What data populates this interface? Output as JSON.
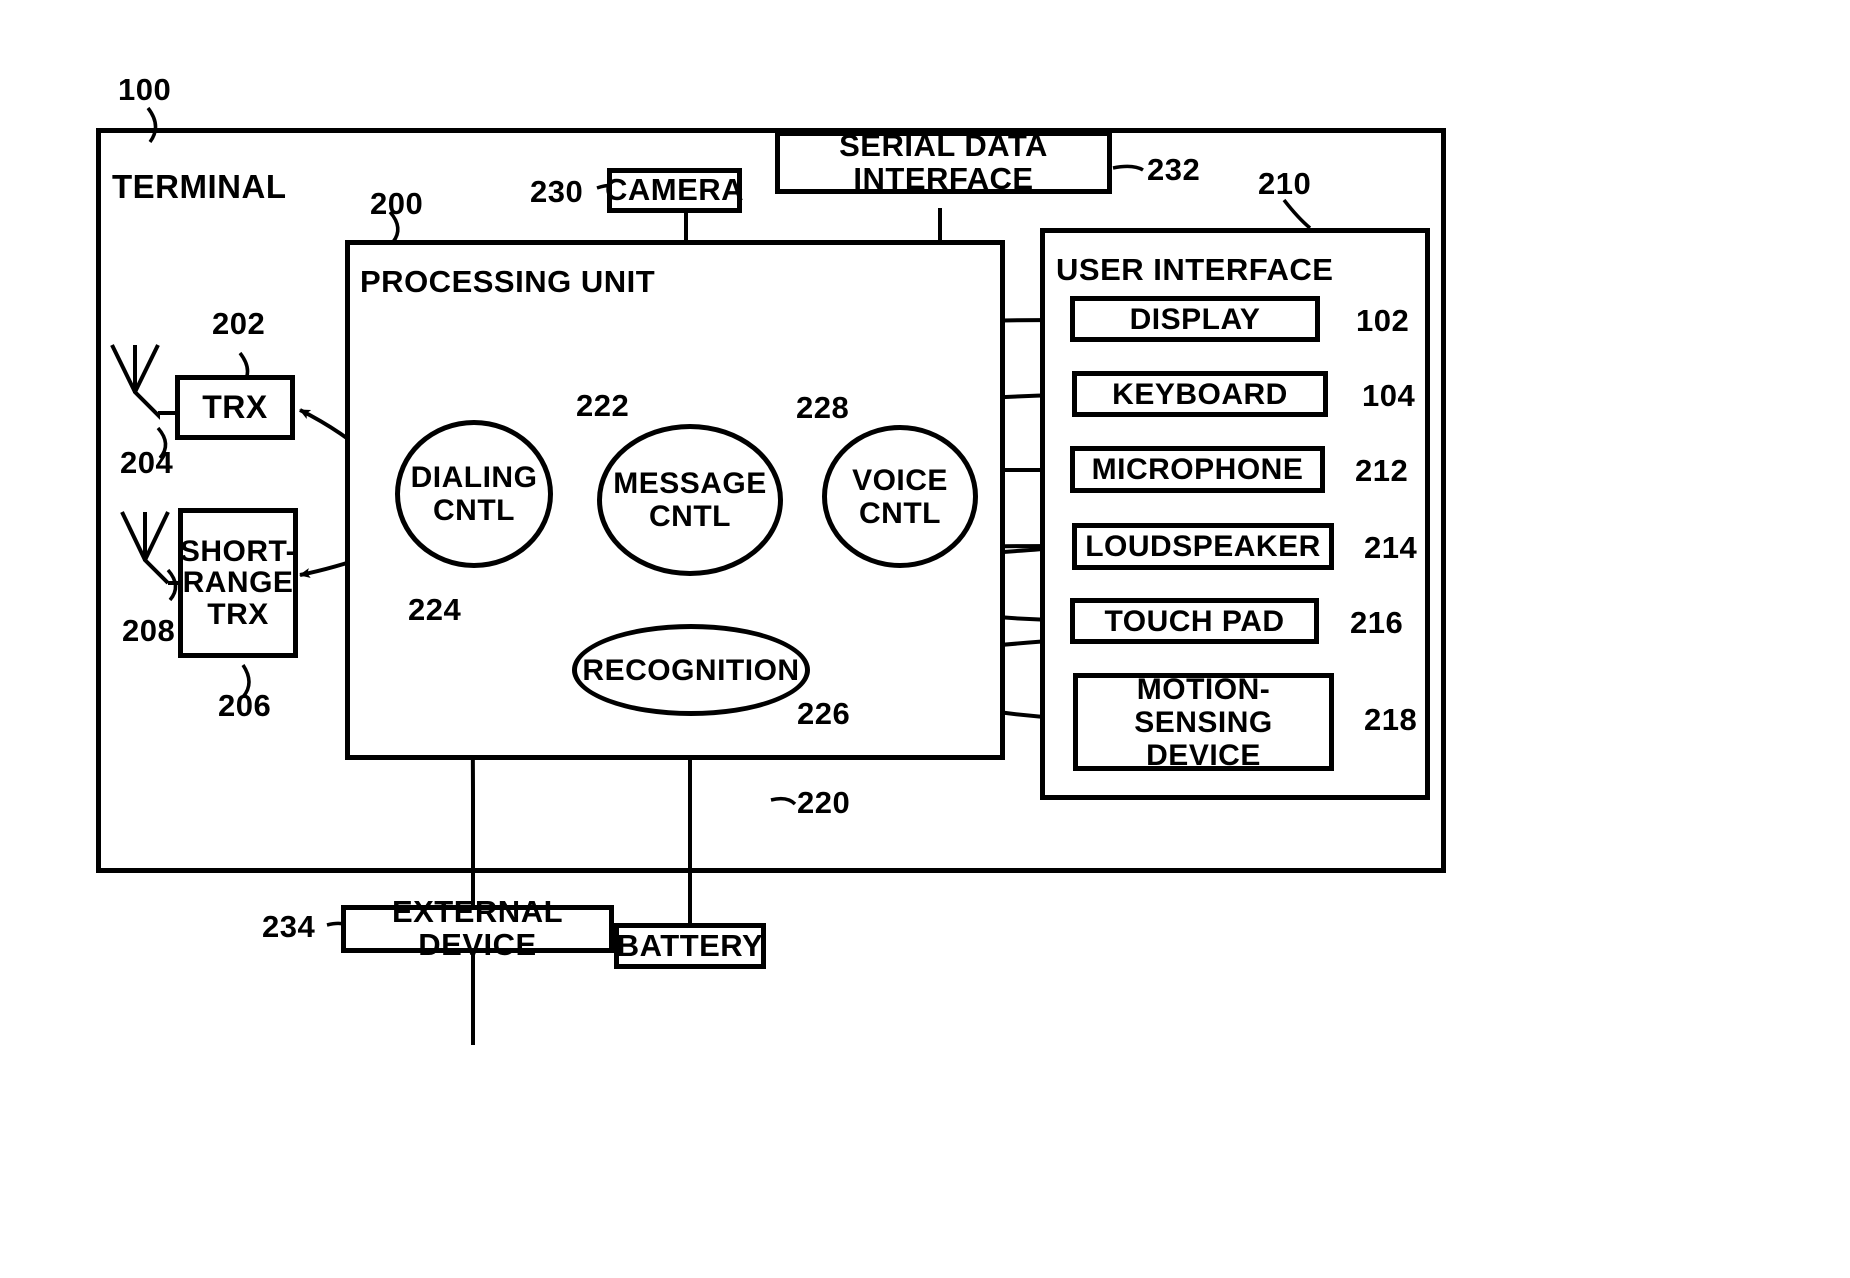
{
  "figure": {
    "outer_ref": "100",
    "outer_label": "TERMINAL"
  },
  "processing_unit": {
    "ref": "200",
    "label": "PROCESSING UNIT",
    "nodes": [
      {
        "id": "dialing",
        "line1": "DIALING",
        "line2": "CNTL",
        "ref": "224"
      },
      {
        "id": "message",
        "line1": "MESSAGE",
        "line2": "CNTL",
        "ref": "222"
      },
      {
        "id": "voice",
        "line1": "VOICE",
        "line2": "CNTL",
        "ref": "228"
      },
      {
        "id": "recognition",
        "line1": "RECOGNITION",
        "line2": "",
        "ref": "226"
      }
    ]
  },
  "radio": {
    "trx": {
      "label": "TRX",
      "ref": "202",
      "antenna_ref": "204"
    },
    "short_range_trx": {
      "label": "SHORT-RANGE TRX",
      "line1": "SHORT-",
      "line2": "RANGE",
      "line3": "TRX",
      "ref": "206",
      "antenna_ref": "208"
    }
  },
  "peripherals": {
    "camera": {
      "label": "CAMERA",
      "ref": "230"
    },
    "serial_data_interface": {
      "label": "SERIAL DATA INTERFACE",
      "ref": "232"
    },
    "battery": {
      "label": "BATTERY",
      "ref": "220"
    },
    "external_device": {
      "label": "EXTERNAL DEVICE",
      "ref": "234"
    }
  },
  "user_interface": {
    "label": "USER INTERFACE",
    "ref": "210",
    "items": [
      {
        "label": "DISPLAY",
        "ref": "102"
      },
      {
        "label": "KEYBOARD",
        "ref": "104"
      },
      {
        "label": "MICROPHONE",
        "ref": "212"
      },
      {
        "label": "LOUDSPEAKER",
        "ref": "214"
      },
      {
        "label": "TOUCH PAD",
        "ref": "216"
      },
      {
        "label": "MOTION-SENSING DEVICE",
        "line1": "MOTION-SENSING",
        "line2": "DEVICE",
        "ref": "218"
      }
    ]
  },
  "colors": {
    "ink": "#000000",
    "paper": "#ffffff"
  }
}
